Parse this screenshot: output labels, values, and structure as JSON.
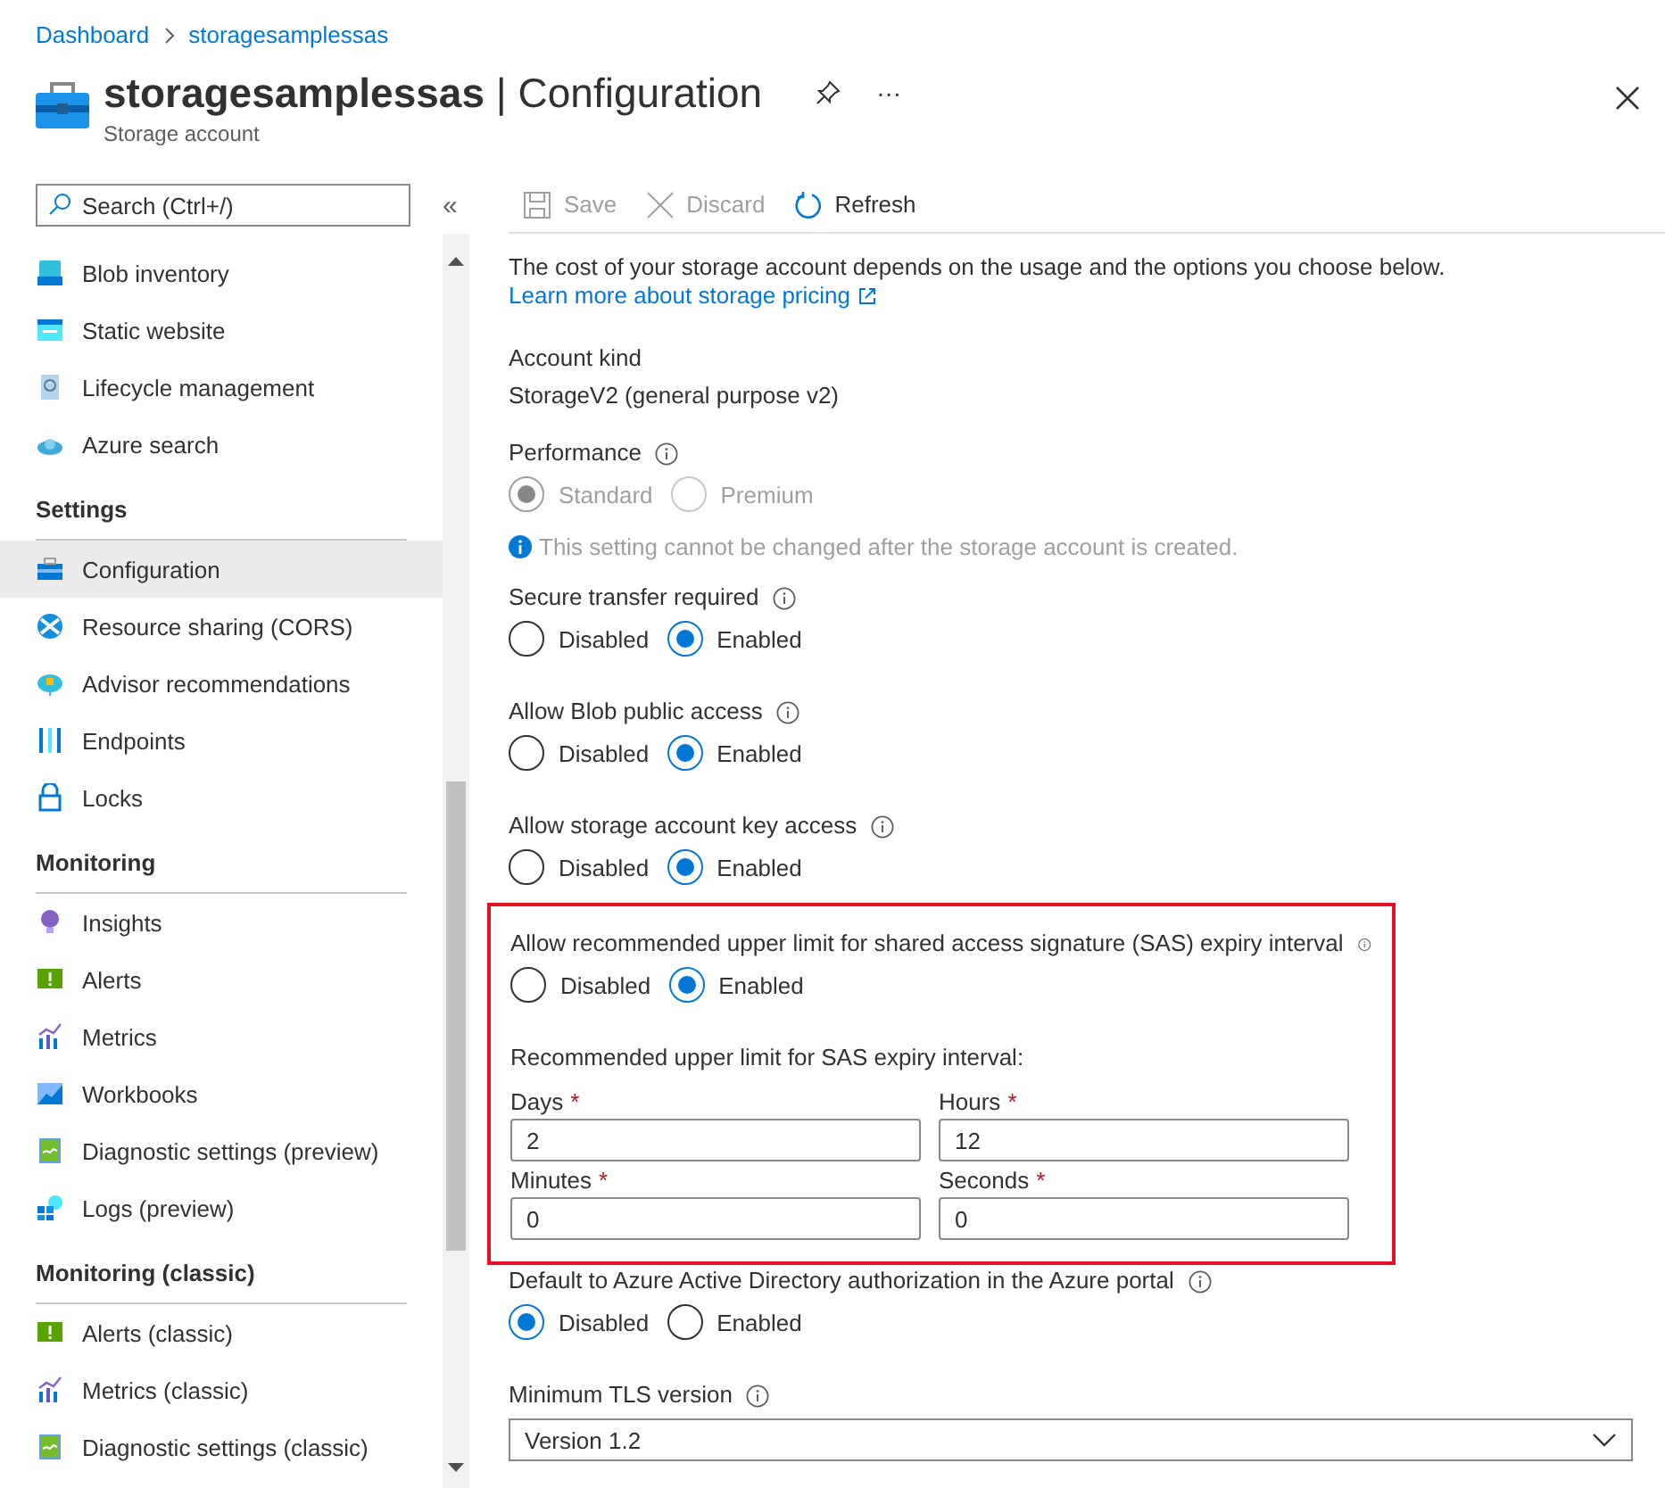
{
  "breadcrumb": [
    "Dashboard",
    "storagesamplessas"
  ],
  "header": {
    "title": "storagesamplessas",
    "separator": "|",
    "section": "Configuration",
    "subtitle": "Storage account",
    "more": "···"
  },
  "sidebar": {
    "search_placeholder": "Search (Ctrl+/)",
    "collapse": "«",
    "groups": [
      {
        "items": [
          {
            "label": "Blob inventory",
            "selected": false
          },
          {
            "label": "Static website",
            "selected": false
          },
          {
            "label": "Lifecycle management",
            "selected": false
          },
          {
            "label": "Azure search",
            "selected": false
          }
        ]
      },
      {
        "heading": "Settings",
        "items": [
          {
            "label": "Configuration",
            "selected": true
          },
          {
            "label": "Resource sharing (CORS)",
            "selected": false
          },
          {
            "label": "Advisor recommendations",
            "selected": false
          },
          {
            "label": "Endpoints",
            "selected": false
          },
          {
            "label": "Locks",
            "selected": false
          }
        ]
      },
      {
        "heading": "Monitoring",
        "items": [
          {
            "label": "Insights",
            "selected": false
          },
          {
            "label": "Alerts",
            "selected": false
          },
          {
            "label": "Metrics",
            "selected": false
          },
          {
            "label": "Workbooks",
            "selected": false
          },
          {
            "label": "Diagnostic settings (preview)",
            "selected": false
          },
          {
            "label": "Logs (preview)",
            "selected": false
          }
        ]
      },
      {
        "heading": "Monitoring (classic)",
        "items": [
          {
            "label": "Alerts (classic)",
            "selected": false
          },
          {
            "label": "Metrics (classic)",
            "selected": false
          },
          {
            "label": "Diagnostic settings (classic)",
            "selected": false
          }
        ]
      }
    ]
  },
  "toolbar": [
    {
      "kind": "save",
      "label": "Save",
      "disabled": true
    },
    {
      "kind": "discard",
      "label": "Discard",
      "disabled": true
    },
    {
      "kind": "refresh",
      "label": "Refresh",
      "disabled": false
    }
  ],
  "intro": {
    "text": "The cost of your storage account depends on the usage and the options you choose below.",
    "link": "Learn more about storage pricing"
  },
  "account_kind": {
    "label": "Account kind",
    "value": "StorageV2 (general purpose v2)"
  },
  "settings": [
    {
      "label": "Performance",
      "disabled": true,
      "note": "This setting cannot be changed after the storage account is created.",
      "options": [
        {
          "label": "Standard",
          "selected": true
        },
        {
          "label": "Premium",
          "selected": false
        }
      ]
    },
    {
      "label": "Secure transfer required",
      "disabled": false,
      "options": [
        {
          "label": "Disabled",
          "selected": false
        },
        {
          "label": "Enabled",
          "selected": true
        }
      ]
    },
    {
      "label": "Allow Blob public access",
      "disabled": false,
      "options": [
        {
          "label": "Disabled",
          "selected": false
        },
        {
          "label": "Enabled",
          "selected": true
        }
      ]
    },
    {
      "label": "Allow storage account key access",
      "disabled": false,
      "options": [
        {
          "label": "Disabled",
          "selected": false
        },
        {
          "label": "Enabled",
          "selected": true
        }
      ]
    }
  ],
  "sas": {
    "highlighted": true,
    "label": "Allow recommended upper limit for shared access signature (SAS) expiry interval",
    "options": [
      {
        "label": "Disabled",
        "selected": false
      },
      {
        "label": "Enabled",
        "selected": true
      }
    ],
    "interval_label": "Recommended upper limit for SAS expiry interval:",
    "fields": [
      {
        "label": "Days",
        "mark": "*",
        "value": "2"
      },
      {
        "label": "Hours",
        "mark": "*",
        "value": "12"
      },
      {
        "label": "Minutes",
        "mark": "*",
        "value": "0"
      },
      {
        "label": "Seconds",
        "mark": "*",
        "value": "0"
      }
    ]
  },
  "aad": {
    "label": "Default to Azure Active Directory authorization in the Azure portal",
    "options": [
      {
        "label": "Disabled",
        "selected": true
      },
      {
        "label": "Enabled",
        "selected": false
      }
    ]
  },
  "tls": {
    "label": "Minimum TLS version",
    "value": "Version 1.2"
  }
}
